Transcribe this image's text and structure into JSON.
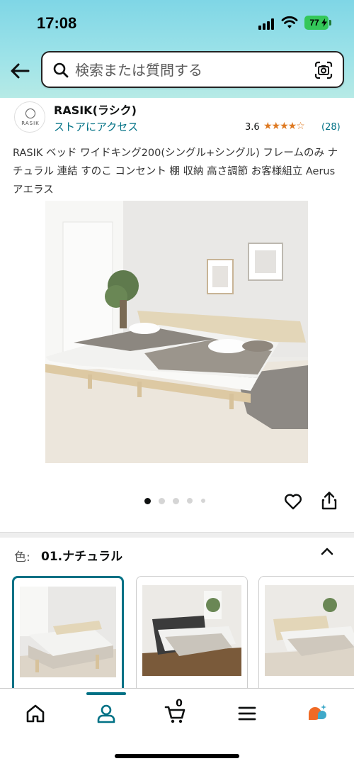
{
  "status_bar": {
    "time": "17:08",
    "battery": "77"
  },
  "search": {
    "placeholder": "検索または質問する"
  },
  "brand": {
    "logo_text": "RASIK",
    "name": "RASIK(ラシク)",
    "store_link": "ストアにアクセス",
    "rating": "3.6",
    "stars": "★★★★☆",
    "rating_count": "(28)"
  },
  "product": {
    "title": "RASIK ベッド ワイドキング200(シングル+シングル) フレームのみ ナチュラル 連結 すのこ コンセント 棚 収納 高さ調節 お客様組立 Aerus アエラス",
    "image_count": 5,
    "current_image": 1
  },
  "variation": {
    "label": "色:",
    "value": "01.ナチュラル",
    "swatch_count": 3,
    "selected_index": 0
  },
  "bottom_nav": {
    "cart_count": "0"
  },
  "colors": {
    "accent": "#007185",
    "star": "#de7921",
    "header_top": "#7fd6e6",
    "header_bottom": "#b6eae6",
    "battery": "#34c759"
  },
  "icons": [
    "back-arrow-icon",
    "search-icon",
    "camera-icon",
    "heart-icon",
    "share-icon",
    "chevron-up-icon",
    "home-icon",
    "account-icon",
    "cart-icon",
    "menu-icon",
    "rufus-icon"
  ]
}
